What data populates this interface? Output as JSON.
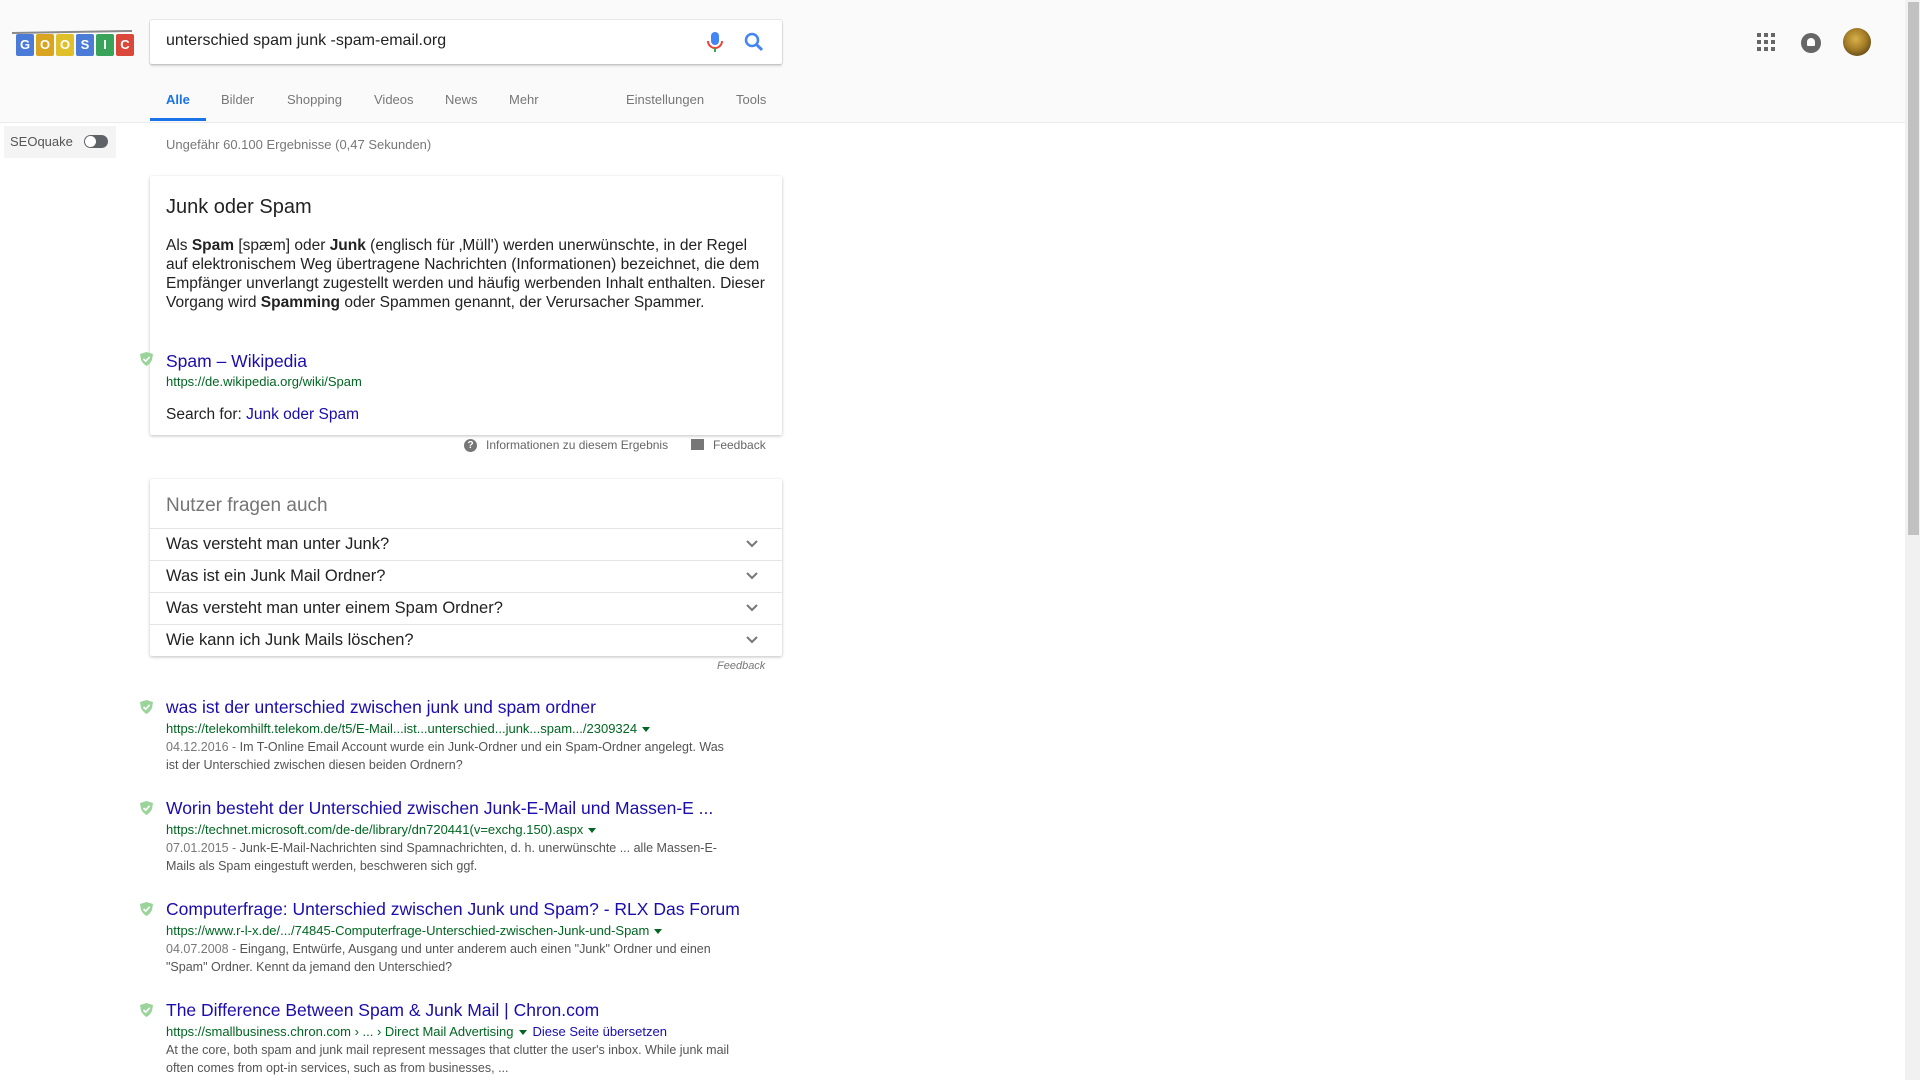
{
  "header": {
    "logo_letters": [
      "G",
      "O",
      "O",
      "S",
      "I",
      "C"
    ],
    "search_query": "unterschied spam junk -spam-email.org",
    "tabs": [
      "Alle",
      "Bilder",
      "Shopping",
      "Videos",
      "News",
      "Mehr"
    ],
    "tools": [
      "Einstellungen",
      "Tools"
    ],
    "colors": {
      "accent": "#1a73e8",
      "link": "#1a0dab",
      "url": "#006621"
    }
  },
  "seoquake": {
    "label": "SEOquake"
  },
  "result_stats": "Ungefähr 60.100 Ergebnisse (0,47 Sekunden)",
  "featured": {
    "title": "Junk oder Spam",
    "desc_parts": {
      "p1": "Als ",
      "b1": "Spam",
      "p2": " [spæm] oder ",
      "b2": "Junk",
      "p3": " (englisch für ‚Müll') werden unerwünschte, in der Regel auf elektronischem Weg übertragene Nachrichten (Informationen) bezeichnet, die dem Empfänger unverlangt zugestellt werden und häufig werbenden Inhalt enthalten. Dieser Vorgang wird ",
      "b3": "Spamming",
      "p4": " oder Spammen genannt, der Verursacher Spammer."
    },
    "link": "Spam – Wikipedia",
    "url": "https://de.wikipedia.org/wiki/Spam",
    "search_for_label": "Search for:",
    "search_for_link": "Junk oder Spam",
    "info_text": "Informationen zu diesem Ergebnis",
    "feedback_text": "Feedback"
  },
  "paa": {
    "title": "Nutzer fragen auch",
    "questions": [
      "Was versteht man unter Junk?",
      "Was ist ein Junk Mail Ordner?",
      "Was versteht man unter einem Spam Ordner?",
      "Wie kann ich Junk Mails löschen?"
    ],
    "feedback": "Feedback"
  },
  "results": [
    {
      "title": "was ist der unterschied zwischen junk und spam ordner",
      "url": "https://telekomhilft.telekom.de/t5/E-Mail...ist...unterschied...junk...spam.../2309324",
      "date": "04.12.2016 - ",
      "snippet_line1": "Im T-Online Email Account wurde ein Junk-Ordner und ein Spam-Ordner angelegt. Was",
      "snippet_line2": "ist der Unterschied zwischen diesen beiden Ordnern?"
    },
    {
      "title": "Worin besteht der Unterschied zwischen Junk-E-Mail und Massen-E ...",
      "url": "https://technet.microsoft.com/de-de/library/dn720441(v=exchg.150).aspx",
      "date": "07.01.2015 - ",
      "snippet_line1": "Junk-E-Mail-Nachrichten sind Spamnachrichten, d. h. unerwünschte ... alle Massen-E-",
      "snippet_line2": "Mails als Spam eingestuft werden, beschweren sich ggf."
    },
    {
      "title": "Computerfrage: Unterschied zwischen Junk und Spam? - RLX Das Forum",
      "url": "https://www.r-l-x.de/.../74845-Computerfrage-Unterschied-zwischen-Junk-und-Spam",
      "date": "04.07.2008 - ",
      "snippet_line1": "Eingang, Entwürfe, Ausgang und unter anderem auch einen \"Junk\" Ordner und einen",
      "snippet_line2": "\"Spam\" Ordner. Kennt da jemand den Unterschied?"
    },
    {
      "title": "The Difference Between Spam & Junk Mail | Chron.com",
      "url": "https://smallbusiness.chron.com › ... › Direct Mail Advertising",
      "translate": "Diese Seite übersetzen",
      "date": "",
      "snippet_line1": "At the core, both spam and junk mail represent messages that clutter the user's inbox. While junk mail",
      "snippet_line2": "often comes from opt-in services, such as from businesses, ..."
    }
  ]
}
